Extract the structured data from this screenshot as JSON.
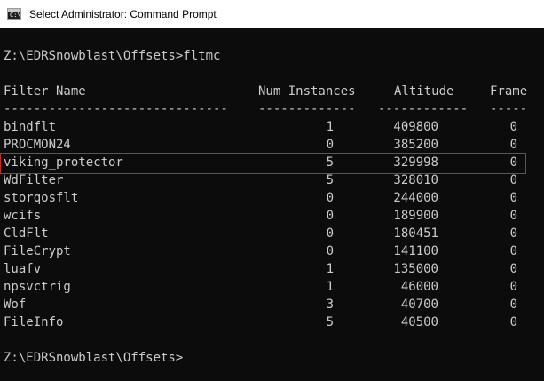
{
  "window": {
    "title": "Select Administrator: Command Prompt",
    "icon": "cmd-icon",
    "icon_text": "C:\\"
  },
  "console": {
    "command_line": "Z:\\EDRSnowblast\\Offsets>fltmc",
    "headers": {
      "filter_name": "Filter Name",
      "num_instances": "Num Instances",
      "altitude": "Altitude",
      "frame": "Frame"
    },
    "separators": {
      "filter_name": "------------------------------",
      "num_instances": "-------------",
      "altitude": "------------",
      "frame": "-----"
    },
    "rows": [
      {
        "name": "bindflt",
        "instances": "1",
        "altitude": "409800",
        "frame": "0"
      },
      {
        "name": "PROCMON24",
        "instances": "0",
        "altitude": "385200",
        "frame": "0"
      },
      {
        "name": "viking_protector",
        "instances": "5",
        "altitude": "329998",
        "frame": "0"
      },
      {
        "name": "WdFilter",
        "instances": "5",
        "altitude": "328010",
        "frame": "0"
      },
      {
        "name": "storqosflt",
        "instances": "0",
        "altitude": "244000",
        "frame": "0"
      },
      {
        "name": "wcifs",
        "instances": "0",
        "altitude": "189900",
        "frame": "0"
      },
      {
        "name": "CldFlt",
        "instances": "0",
        "altitude": "180451",
        "frame": "0"
      },
      {
        "name": "FileCrypt",
        "instances": "0",
        "altitude": "141100",
        "frame": "0"
      },
      {
        "name": "luafv",
        "instances": "1",
        "altitude": "135000",
        "frame": "0"
      },
      {
        "name": "npsvctrig",
        "instances": "1",
        "altitude": "46000",
        "frame": "0"
      },
      {
        "name": "Wof",
        "instances": "3",
        "altitude": "40700",
        "frame": "0"
      },
      {
        "name": "FileInfo",
        "instances": "5",
        "altitude": "40500",
        "frame": "0"
      }
    ],
    "prompt": "Z:\\EDRSnowblast\\Offsets>",
    "highlighted_row": "viking_protector",
    "highlight_color": "#c42b1c",
    "text_color": "#cccccc",
    "background_color": "#0c0c0c"
  }
}
